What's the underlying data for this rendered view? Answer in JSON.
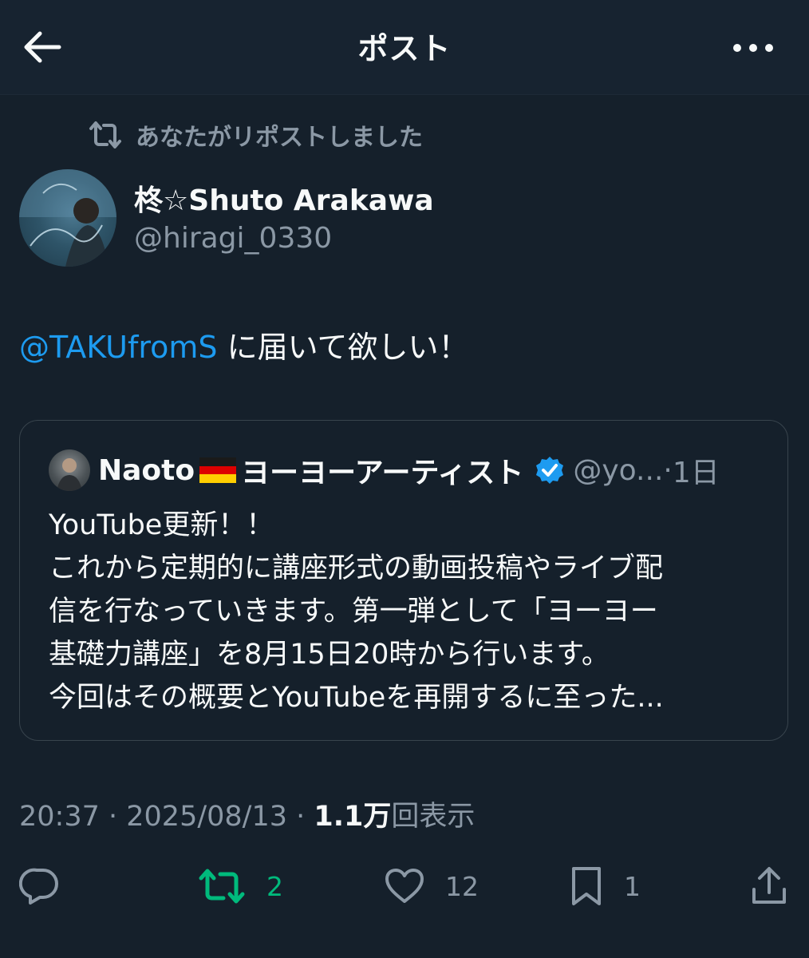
{
  "header": {
    "title": "ポスト",
    "back_icon": "arrow-left-icon",
    "more_icon": "more-horizontal-icon"
  },
  "repost_context": {
    "icon": "repost-icon",
    "text": "あなたがリポストしました"
  },
  "author": {
    "display_name": "柊☆Shuto Arakawa",
    "handle": "@hiragi_0330"
  },
  "post": {
    "mention": "@TAKUfromS",
    "text": " に届いて欲しい！"
  },
  "quote": {
    "author_name": "Naoto",
    "author_name_suffix": "ヨーヨーアーティスト",
    "flag": "germany-flag",
    "verified_icon": "verified-badge-icon",
    "handle": "@yo...",
    "separator": "·",
    "time": "1日",
    "lines": [
      "YouTube更新！！",
      "これから定期的に講座形式の動画投稿やライブ配",
      "信を行なっていきます。第一弾として「ヨーヨー",
      "基礎力講座」を8月15日20時から行います。",
      "今回はその概要とYouTubeを再開するに至った..."
    ]
  },
  "meta": {
    "time": "20:37",
    "sep1": " · ",
    "date": "2025/08/13",
    "sep2": " · ",
    "views_count": "1.1万",
    "views_label": "回表示"
  },
  "actions": {
    "reply_icon": "reply-icon",
    "repost_icon": "repost-icon",
    "repost_count": "2",
    "like_icon": "heart-icon",
    "like_count": "12",
    "bookmark_icon": "bookmark-icon",
    "bookmark_count": "1",
    "share_icon": "share-icon"
  },
  "colors": {
    "background": "#15202b",
    "text": "#f7f9f9",
    "muted": "#8b98a5",
    "link": "#1d9bf0",
    "repost_active": "#00ba7c",
    "border": "#38444d"
  }
}
